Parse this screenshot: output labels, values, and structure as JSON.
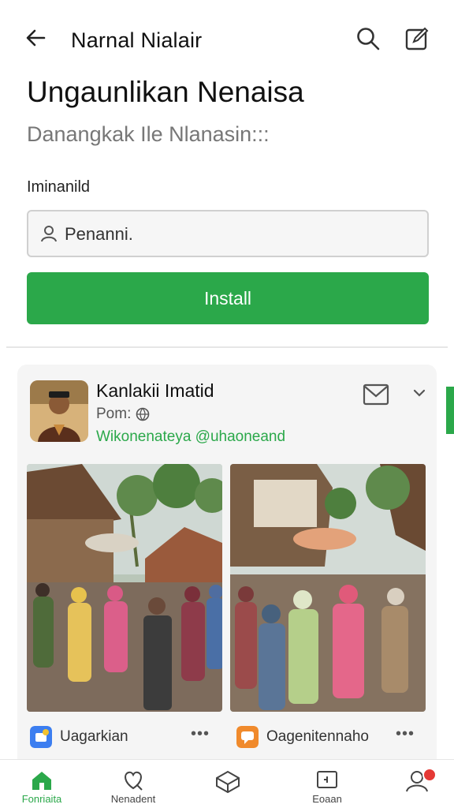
{
  "header": {
    "title": "Narnal Nialair",
    "back_icon": "arrow-left-icon",
    "search_icon": "search-icon",
    "compose_icon": "compose-icon"
  },
  "intro": {
    "heading": "Ungaunlikan Nenaisa",
    "subheading": "Danangkak Ile Nlanasin:::",
    "field_label": "Iminanild",
    "input_placeholder": "Penanni.",
    "install_label": "Install"
  },
  "colors": {
    "accent": "#2ba84a",
    "badge": "#e53935"
  },
  "card": {
    "name": "Kanlakii Imatid",
    "meta": "Pom:",
    "handle": "Wikonenateya @uhaoneand",
    "mail_icon": "mail-icon",
    "chevron_icon": "chevron-down-icon",
    "apps": [
      {
        "label": "Uagarkian",
        "icon": "blue-app-icon",
        "more": "•••"
      },
      {
        "label": "Oagenitennaho",
        "icon": "orange-chat-icon",
        "more": "•••"
      }
    ]
  },
  "bottom_nav": {
    "items": [
      {
        "label": "Fonriaita",
        "icon": "home-icon"
      },
      {
        "label": "Nenadent",
        "icon": "heart-chat-icon"
      },
      {
        "label": "",
        "icon": "box-icon"
      },
      {
        "label": "Eoaan",
        "icon": "card-icon"
      },
      {
        "label": "",
        "icon": "profile-icon"
      }
    ]
  }
}
